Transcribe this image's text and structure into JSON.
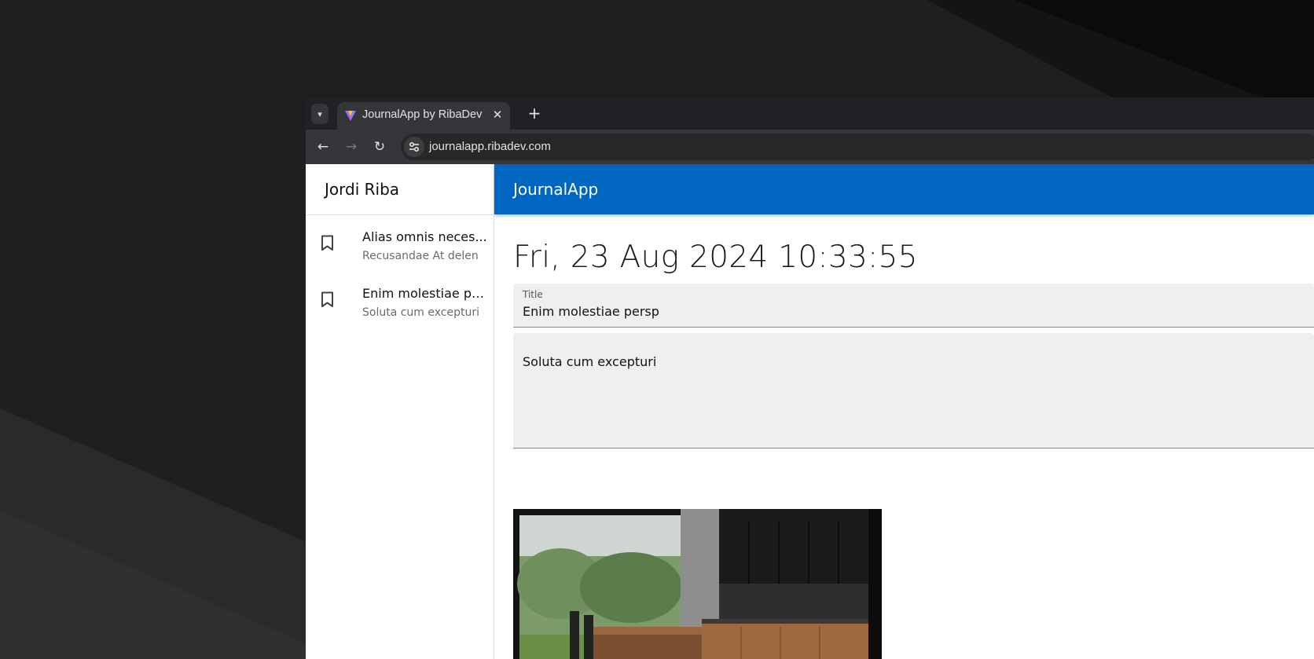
{
  "browser": {
    "tab_title": "JournalApp by RibaDev",
    "url": "journalapp.ribadev.com"
  },
  "sidebar": {
    "user_name": "Jordi Riba",
    "entries": [
      {
        "title": "Alias omnis neces...",
        "subtitle": "Recusandae At delen"
      },
      {
        "title": "Enim molestiae pe...",
        "subtitle": "Soluta cum excepturi"
      }
    ]
  },
  "appbar": {
    "title": "JournalApp"
  },
  "note": {
    "date": "Fri, 23 Aug 2024 10:33:55",
    "title_label": "Title",
    "title_value": "Enim molestiae persp",
    "body_value": "Soluta cum excepturi"
  },
  "icons": {
    "entry_icon": "bookmark-icon",
    "back": "arrow-back-icon",
    "forward": "arrow-forward-icon",
    "reload": "reload-icon",
    "site_info": "tune-icon"
  },
  "colors": {
    "appbar": "#0066bf",
    "browser_frame": "#202124",
    "toolbar": "#35363a"
  }
}
